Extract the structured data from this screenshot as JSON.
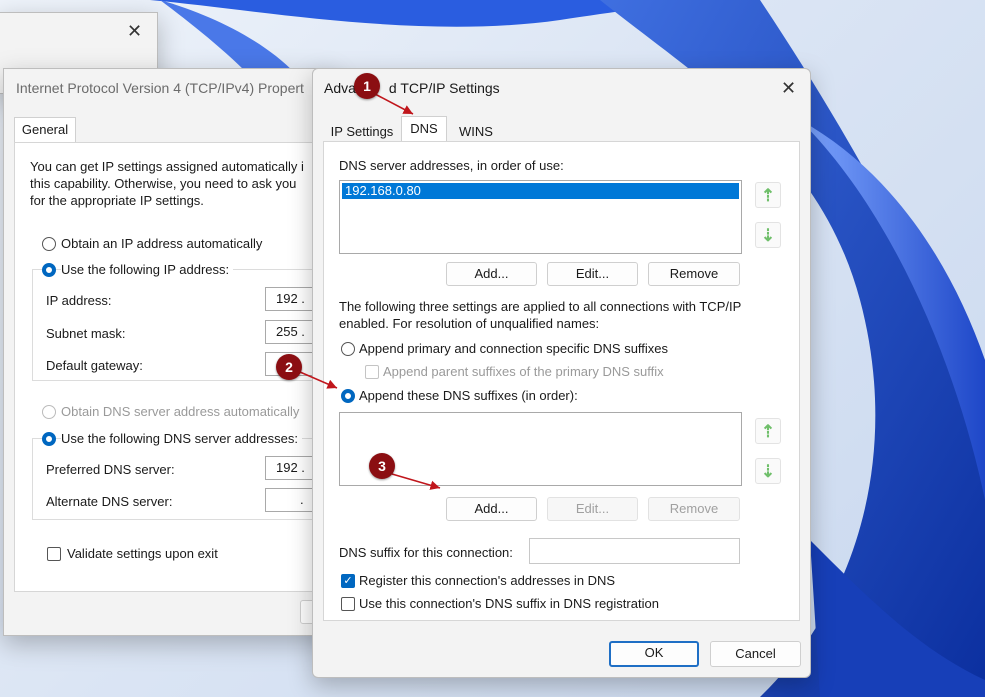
{
  "colors": {
    "accent": "#0067c0",
    "annotation": "#8b0e12",
    "arrow_green": "#6fbf6a"
  },
  "bg_window": {
    "close_icon": "close-icon"
  },
  "ipv4": {
    "title": "Internet Protocol Version 4 (TCP/IPv4) Propert",
    "tab_general": "General",
    "intro_line1": "You can get IP settings assigned automatically i",
    "intro_line2": "this capability. Otherwise, you need to ask you",
    "intro_line3": "for the appropriate IP settings.",
    "obtain_ip_auto": "Obtain an IP address automatically",
    "use_following_ip": "Use the following IP address:",
    "ip_address_label": "IP address:",
    "ip_address_value": "192 .",
    "subnet_label": "Subnet mask:",
    "subnet_value": "255 .",
    "gateway_label": "Default gateway:",
    "obtain_dns_auto": "Obtain DNS server address automatically",
    "use_following_dns": "Use the following DNS server addresses:",
    "preferred_dns_label": "Preferred DNS server:",
    "preferred_dns_value": "192 .",
    "alternate_dns_label": "Alternate DNS server:",
    "alternate_dns_value": ".",
    "validate_label": "Validate settings upon exit"
  },
  "advanced": {
    "title": "Advanced TCP/IP Settings",
    "title_left": "Adva",
    "title_right": "d TCP/IP Settings",
    "tabs": [
      "IP Settings",
      "DNS",
      "WINS"
    ],
    "active_tab": "DNS",
    "dns_servers_label": "DNS server addresses, in order of use:",
    "dns_servers": [
      "192.168.0.80"
    ],
    "add_label": "Add...",
    "edit_label": "Edit...",
    "remove_label": "Remove",
    "info_line1": "The following three settings are applied to all connections with TCP/IP",
    "info_line2": "enabled. For resolution of unqualified names:",
    "append_primary": "Append primary and connection specific DNS suffixes",
    "append_parent": "Append parent suffixes of the primary DNS suffix",
    "append_these": "Append these DNS suffixes (in order):",
    "suffix_conn_label": "DNS suffix for this connection:",
    "suffix_conn_value": "",
    "register_label": "Register this connection's addresses in DNS",
    "use_suffix_label": "Use this connection's DNS suffix in DNS registration",
    "ok_label": "OK",
    "cancel_label": "Cancel",
    "up_icon": "move-up-icon",
    "down_icon": "move-down-icon"
  },
  "annotations": [
    "1",
    "2",
    "3"
  ]
}
